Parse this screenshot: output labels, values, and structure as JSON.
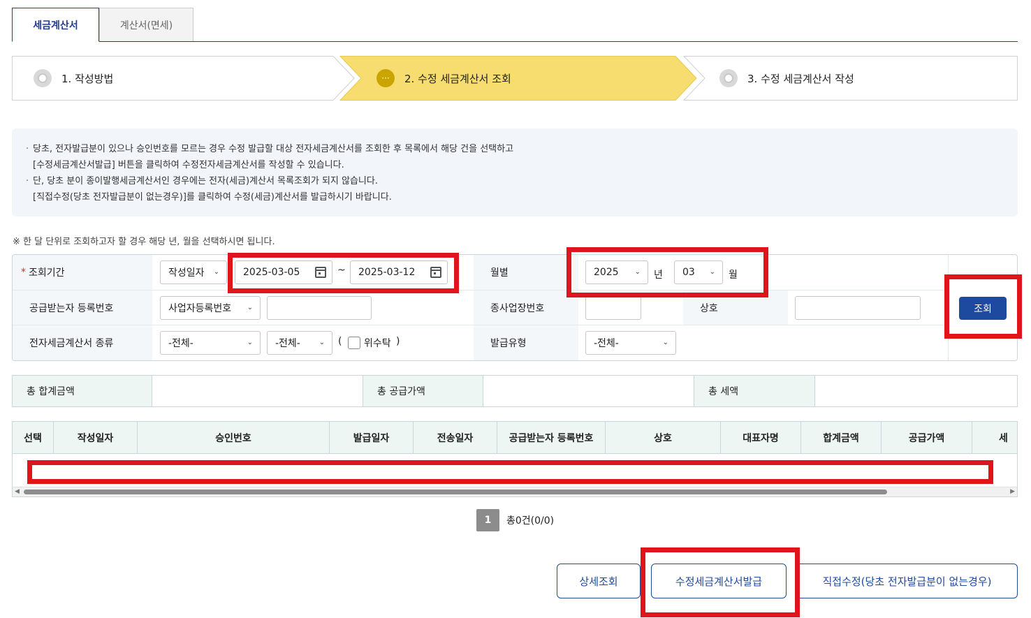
{
  "tabs": [
    {
      "label": "세금계산서",
      "active": true
    },
    {
      "label": "계산서(면세)",
      "active": false
    }
  ],
  "steps": [
    {
      "label": "1. 작성방법",
      "state": "done"
    },
    {
      "label": "2. 수정 세금계산서 조회",
      "state": "active"
    },
    {
      "label": "3. 수정 세금계산서 작성",
      "state": "pending"
    }
  ],
  "notice": {
    "lines": [
      "당초, 전자발급분이 있으나 승인번호를 모르는 경우 수정 발급할 대상 전자세금계산서를 조회한 후 목록에서 해당 건을 선택하고",
      "[수정세금계산서발급] 버튼을 클릭하여 수정전자세금계산서를 작성할 수 있습니다.",
      "단, 당초 분이 종이발행세금계산서인 경우에는 전자(세금)계산서 목록조회가 되지 않습니다.",
      "[직접수정(당초 전자발급분이 없는경우)]를 클릭하여 수정(세금)계산서를 발급하시기 바랍니다."
    ]
  },
  "hint": "※ 한 달 단위로 조회하고자 할 경우 해당 년, 월을 선택하시면 됩니다.",
  "search": {
    "period_label": "조회기간",
    "required_mark": "*",
    "date_type": "작성일자",
    "date_from": "2025-03-05",
    "date_sep": "~",
    "date_to": "2025-03-12",
    "monthly_label": "월별",
    "year": "2025",
    "year_unit": "년",
    "month": "03",
    "month_unit": "월",
    "recipient_label": "공급받는자 등록번호",
    "recipient_type": "사업자등록번호",
    "recipient_value": "",
    "branch_label": "종사업장번호",
    "branch_value": "",
    "company_label": "상호",
    "company_value": "",
    "kind_label": "전자세금계산서 종류",
    "kind1": "-전체-",
    "kind2": "-전체-",
    "consign_open": "(",
    "consign_label": "위수탁",
    "consign_close": ")",
    "issue_type_label": "발급유형",
    "issue_type": "-전체-",
    "search_button": "조회"
  },
  "totals": {
    "sum_label": "총 합계금액",
    "sum_value": "",
    "supply_label": "총 공급가액",
    "supply_value": "",
    "tax_label": "총 세액",
    "tax_value": ""
  },
  "grid": {
    "columns": [
      "선택",
      "작성일자",
      "승인번호",
      "발급일자",
      "전송일자",
      "공급받는자 등록번호",
      "상호",
      "대표자명",
      "합계금액",
      "공급가액",
      "세"
    ]
  },
  "pagination": {
    "current": "1",
    "info": "총0건(0/0)"
  },
  "buttons": {
    "detail": "상세조회",
    "amend_issue": "수정세금계산서발급",
    "direct_amend": "직접수정(당초 전자발급분이 없는경우)"
  },
  "colors": {
    "accent": "#1d4a9e",
    "step_active": "#f7dc6f",
    "annotation": "#e0141b"
  }
}
